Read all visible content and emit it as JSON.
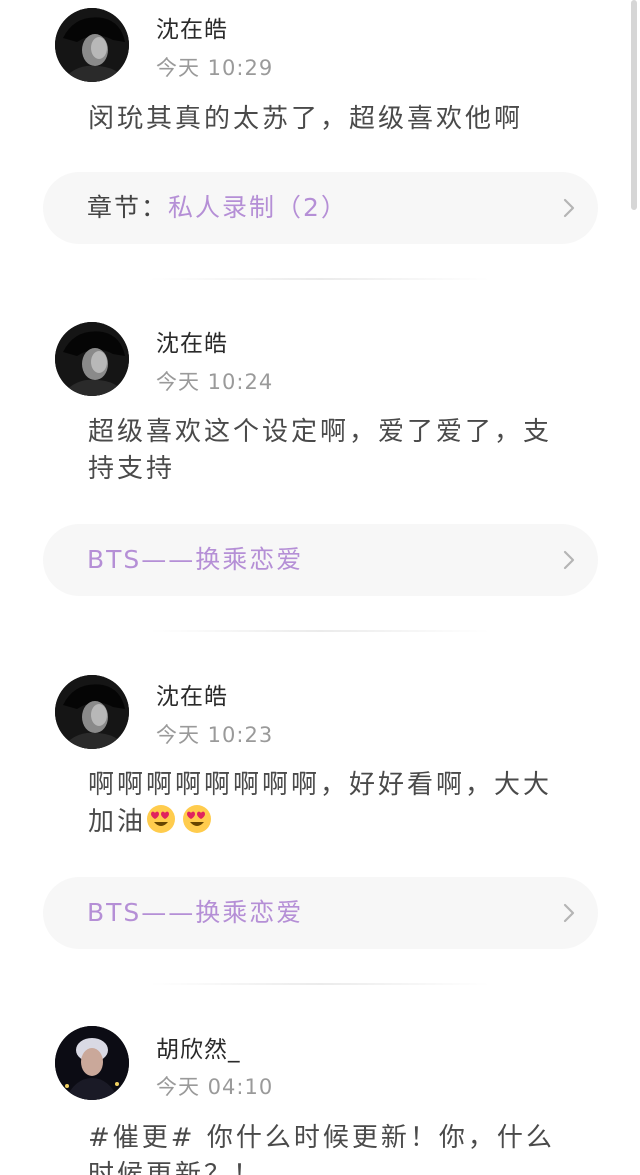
{
  "colors": {
    "accent": "#b58fd6",
    "card_bg": "#f7f7f7",
    "username": "#2a2a2a",
    "time": "#9a9a9a",
    "content": "#4a4a4a"
  },
  "comments": [
    {
      "username": "沈在皓",
      "time": "今天 10:29",
      "text": "闵玧其真的太苏了，超级喜欢他啊",
      "chapter_prefix": "章节：",
      "chapter_title": "私人录制（2）",
      "avatar_icon": "dark-portrait-avatar"
    },
    {
      "username": "沈在皓",
      "time": "今天 10:24",
      "text": "超级喜欢这个设定啊，爱了爱了，支持支持",
      "chapter_prefix": "",
      "chapter_title": "BTS——换乘恋爱",
      "avatar_icon": "dark-portrait-avatar"
    },
    {
      "username": "沈在皓",
      "time": "今天 10:23",
      "text": "啊啊啊啊啊啊啊啊，好好看啊，大大加油",
      "emoji": "heart-eyes-emoji",
      "chapter_prefix": "",
      "chapter_title": "BTS——换乘恋爱",
      "avatar_icon": "dark-portrait-avatar"
    },
    {
      "username": "胡欣然_",
      "time": "今天 04:10",
      "text": "#催更# 你什么时候更新！你，什么时候更新？！",
      "avatar_icon": "concert-portrait-avatar"
    }
  ]
}
